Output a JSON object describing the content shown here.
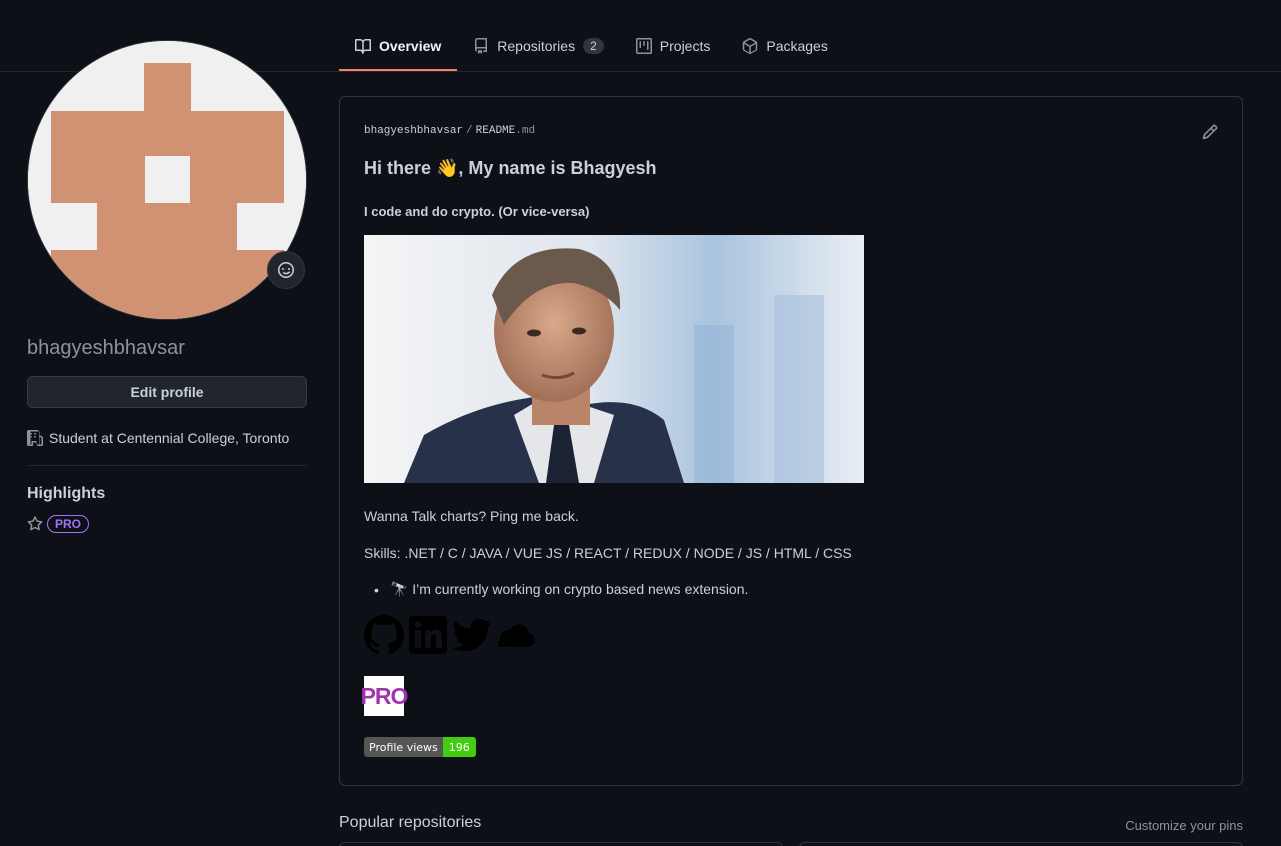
{
  "tabs": [
    {
      "label": "Overview",
      "icon": "book-icon"
    },
    {
      "label": "Repositories",
      "icon": "repo-icon",
      "count": "2"
    },
    {
      "label": "Projects",
      "icon": "project-icon"
    },
    {
      "label": "Packages",
      "icon": "package-icon"
    }
  ],
  "profile": {
    "username": "bhagyeshbhavsar",
    "edit_label": "Edit profile",
    "location": "Student at Centennial College, Toronto",
    "highlights_title": "Highlights",
    "pro_badge": "PRO",
    "avatar_colors": {
      "fg": "#d19273",
      "bg": "#f0f0f0"
    }
  },
  "readme": {
    "owner": "bhagyeshbhavsar",
    "separator": "/",
    "file_name": "README",
    "file_ext": ".md",
    "heading": "Hi there 👋, My name is Bhagyesh",
    "tagline": "I code and do crypto. (Or vice-versa)",
    "talk": "Wanna Talk charts? Ping me back.",
    "skills": "Skills: .NET / C / JAVA / VUE JS / REACT / REDUX / NODE / JS / HTML / CSS",
    "bullet": "🔭 I’m currently working on crypto based news extension.",
    "pro_image_text": "PRO",
    "views_label": "Profile views",
    "views_count": "196"
  },
  "popular": {
    "title": "Popular repositories",
    "customize": "Customize your pins"
  },
  "colors": {
    "accent": "#f78166",
    "pro": "#a371f7",
    "views_green": "#44cc11"
  }
}
